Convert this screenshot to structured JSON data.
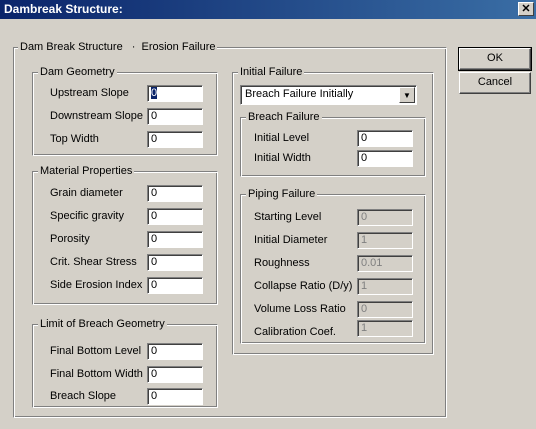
{
  "window": {
    "title": "Dambreak Structure:",
    "close_glyph": "✕"
  },
  "tabs": {
    "active": "Dam Break Structure",
    "separator": "·",
    "inactive": "Erosion Failure"
  },
  "buttons": {
    "ok": "OK",
    "cancel": "Cancel"
  },
  "dam_geometry": {
    "legend": "Dam Geometry",
    "upstream_slope": {
      "label": "Upstream Slope",
      "value": "0"
    },
    "downstream_slope": {
      "label": "Downstream Slope",
      "value": "0"
    },
    "top_width": {
      "label": "Top Width",
      "value": "0"
    }
  },
  "material": {
    "legend": "Material Properties",
    "grain_diameter": {
      "label": "Grain diameter",
      "value": "0"
    },
    "specific_gravity": {
      "label": "Specific gravity",
      "value": "0"
    },
    "porosity": {
      "label": "Porosity",
      "value": "0"
    },
    "crit_shear": {
      "label": "Crit. Shear Stress",
      "value": "0"
    },
    "side_erosion": {
      "label": "Side Erosion Index",
      "value": "0"
    }
  },
  "limit": {
    "legend": "Limit of Breach Geometry",
    "final_bottom_level": {
      "label": "Final Bottom Level",
      "value": "0"
    },
    "final_bottom_width": {
      "label": "Final Bottom Width",
      "value": "0"
    },
    "breach_slope": {
      "label": "Breach Slope",
      "value": "0"
    }
  },
  "initial_failure": {
    "legend": "Initial Failure",
    "mode_selected": "Breach Failure Initially",
    "breach": {
      "legend": "Breach Failure",
      "initial_level": {
        "label": "Initial Level",
        "value": "0"
      },
      "initial_width": {
        "label": "Initial Width",
        "value": "0"
      }
    },
    "piping": {
      "legend": "Piping Failure",
      "starting_level": {
        "label": "Starting Level",
        "value": "0"
      },
      "initial_diameter": {
        "label": "Initial Diameter",
        "value": "1"
      },
      "roughness": {
        "label": "Roughness",
        "value": "0.01"
      },
      "collapse_ratio": {
        "label": "Collapse Ratio (D/y)",
        "value": "1"
      },
      "volume_loss": {
        "label": "Volume Loss Ratio",
        "value": "0"
      },
      "calibration": {
        "label": "Calibration Coef.",
        "value": "1"
      }
    }
  },
  "colors": {
    "face": "#d4d0c8",
    "title_start": "#0a246a",
    "title_end": "#3a6ea5",
    "disabled_text": "#808080"
  }
}
